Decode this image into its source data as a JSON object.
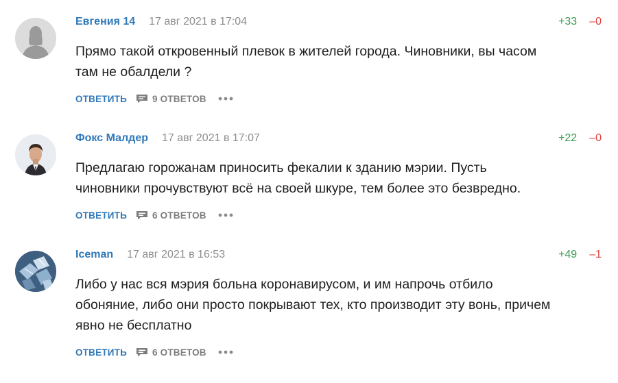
{
  "comments": [
    {
      "author": "Евгения 14",
      "date": "17 авг 2021 в 17:04",
      "plus": "+33",
      "minus": "–0",
      "text_lines": [
        "Прямо такой откровенный плевок в жителей города. Чиновники, вы часом",
        "там не обалдели ?"
      ],
      "reply_label": "ОТВЕТИТЬ",
      "replies_label": "9 ОТВЕТОВ",
      "avatar": "default-user-icon"
    },
    {
      "author": "Фокс Малдер",
      "date": "17 авг 2021 в 17:07",
      "plus": "+22",
      "minus": "–0",
      "text_lines": [
        "Предлагаю горожанам приносить фекалии к зданию мэрии. Пусть",
        "чиновники прочувствуют всё на своей шкуре, тем более это безвредно."
      ],
      "reply_label": "ОТВЕТИТЬ",
      "replies_label": "6 ОТВЕТОВ",
      "avatar": "portrait-photo"
    },
    {
      "author": "Iceman",
      "date": "17 авг 2021 в 16:53",
      "plus": "+49",
      "minus": "–1",
      "text_lines": [
        "Либо у нас вся мэрия больна коронавирусом, и им напрочь отбило",
        "обоняние, либо они просто покрывают тех, кто производит эту вонь, причем",
        "явно не бесплатно"
      ],
      "reply_label": "ОТВЕТИТЬ",
      "replies_label": "6 ОТВЕТОВ",
      "avatar": "ice-cubes-photo"
    }
  ],
  "colors": {
    "link": "#2f79b9",
    "plus": "#3a9a52",
    "minus": "#e0413b",
    "meta": "#8c8c8c"
  }
}
